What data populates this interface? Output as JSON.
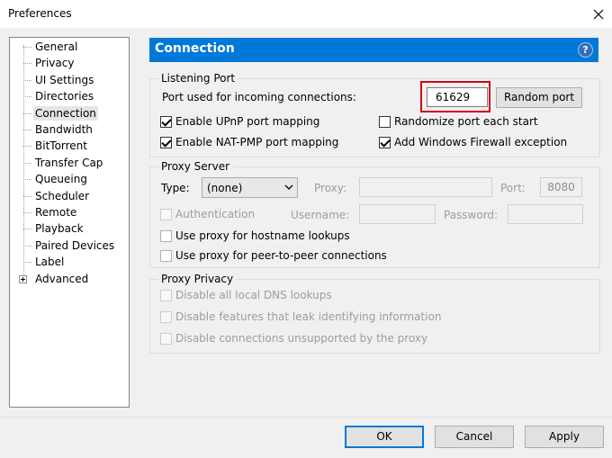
{
  "window": {
    "title": "Preferences"
  },
  "tree": {
    "items": [
      {
        "label": "General"
      },
      {
        "label": "Privacy"
      },
      {
        "label": "UI Settings"
      },
      {
        "label": "Directories"
      },
      {
        "label": "Connection",
        "selected": true
      },
      {
        "label": "Bandwidth"
      },
      {
        "label": "BitTorrent"
      },
      {
        "label": "Transfer Cap"
      },
      {
        "label": "Queueing"
      },
      {
        "label": "Scheduler"
      },
      {
        "label": "Remote"
      },
      {
        "label": "Playback"
      },
      {
        "label": "Paired Devices"
      },
      {
        "label": "Label"
      },
      {
        "label": "Advanced",
        "expandable": true
      }
    ]
  },
  "header": {
    "title": "Connection",
    "help_icon": "?"
  },
  "listening_port": {
    "legend": "Listening Port",
    "port_label": "Port used for incoming connections:",
    "port_value": "61629",
    "random_port_button": "Random port",
    "upnp": {
      "label": "Enable UPnP port mapping",
      "checked": true
    },
    "randomize": {
      "label": "Randomize port each start",
      "checked": false
    },
    "natpmp": {
      "label": "Enable NAT-PMP port mapping",
      "checked": true
    },
    "firewall": {
      "label": "Add Windows Firewall exception",
      "checked": true
    }
  },
  "proxy_server": {
    "legend": "Proxy Server",
    "type_label": "Type:",
    "type_value": "(none)",
    "proxy_label": "Proxy:",
    "proxy_value": "",
    "port_label": "Port:",
    "port_value": "8080",
    "authentication": {
      "label": "Authentication",
      "checked": false
    },
    "username_label": "Username:",
    "username_value": "",
    "password_label": "Password:",
    "password_value": "",
    "hostname_lookups": {
      "label": "Use proxy for hostname lookups",
      "checked": false
    },
    "peer_connections": {
      "label": "Use proxy for peer-to-peer connections",
      "checked": false
    }
  },
  "proxy_privacy": {
    "legend": "Proxy Privacy",
    "dns": {
      "label": "Disable all local DNS lookups",
      "checked": false
    },
    "leak": {
      "label": "Disable features that leak identifying information",
      "checked": false
    },
    "unsupported": {
      "label": "Disable connections unsupported by the proxy",
      "checked": false
    }
  },
  "buttons": {
    "ok": "OK",
    "cancel": "Cancel",
    "apply": "Apply"
  },
  "colors": {
    "accent": "#0078d7",
    "highlight": "#d0021b"
  }
}
